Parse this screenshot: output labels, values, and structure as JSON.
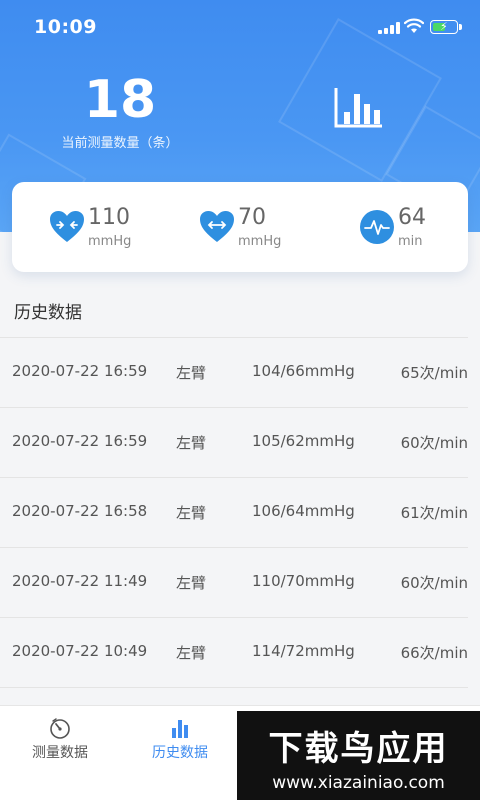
{
  "status_bar": {
    "time": "10:09"
  },
  "header": {
    "count": "18",
    "count_label": "当前测量数量（条）",
    "chart_icon": "bar-chart-icon"
  },
  "summary": {
    "systolic": {
      "value": "110",
      "unit": "mmHg",
      "icon": "heart-compress-icon"
    },
    "diastolic": {
      "value": "70",
      "unit": "mmHg",
      "icon": "heart-expand-icon"
    },
    "pulse": {
      "value": "64",
      "unit": "min",
      "icon": "pulse-wave-icon"
    }
  },
  "history": {
    "title": "历史数据",
    "rows": [
      {
        "date": "2020-07-22 16:59",
        "arm": "左臂",
        "bp": "104/66mmHg",
        "hr": "65次/min"
      },
      {
        "date": "2020-07-22 16:59",
        "arm": "左臂",
        "bp": "105/62mmHg",
        "hr": "60次/min"
      },
      {
        "date": "2020-07-22 16:58",
        "arm": "左臂",
        "bp": "106/64mmHg",
        "hr": "61次/min"
      },
      {
        "date": "2020-07-22 11:49",
        "arm": "左臂",
        "bp": "110/70mmHg",
        "hr": "60次/min"
      },
      {
        "date": "2020-07-22 10:49",
        "arm": "左臂",
        "bp": "114/72mmHg",
        "hr": "66次/min"
      },
      {
        "date": "",
        "arm": "",
        "bp": "",
        "hr": ""
      }
    ]
  },
  "tabbar": {
    "tabs": [
      {
        "label": "测量数据",
        "icon": "gauge-icon"
      },
      {
        "label": "历史数据",
        "icon": "bar-chart-icon"
      }
    ]
  },
  "watermark": {
    "main": "下载鸟应用",
    "url": "www.xiazainiao.com"
  },
  "colors": {
    "primary": "#3f8cf0",
    "heart": "#2e8fe0"
  }
}
